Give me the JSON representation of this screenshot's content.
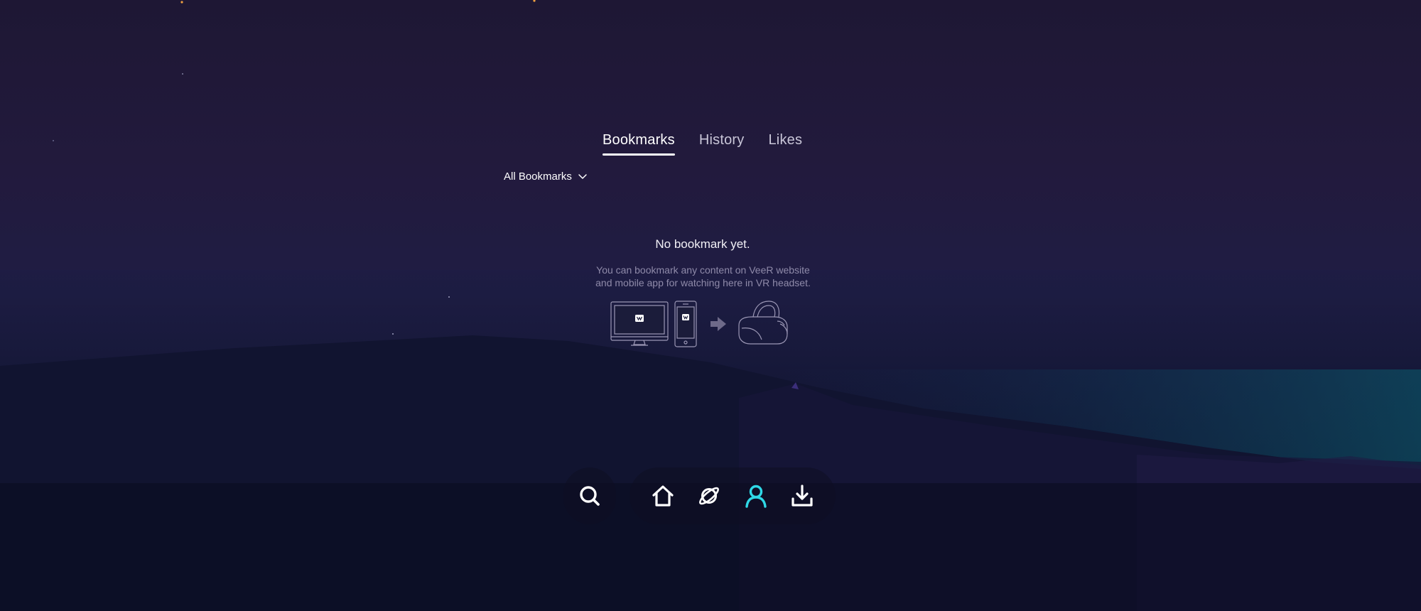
{
  "tabs": [
    {
      "label": "Bookmarks",
      "active": true
    },
    {
      "label": "History",
      "active": false
    },
    {
      "label": "Likes",
      "active": false
    }
  ],
  "filter": {
    "label": "All Bookmarks",
    "icon": "chevron-down-icon"
  },
  "empty_state": {
    "title": "No bookmark yet.",
    "description_line1": "You can bookmark any content on VeeR website",
    "description_line2": "and mobile app for watching here in VR headset.",
    "illustration": [
      "monitor-icon",
      "phone-icon",
      "arrow-right-icon",
      "vr-headset-icon"
    ]
  },
  "bottom_nav": {
    "search": {
      "icon": "search-icon"
    },
    "items": [
      {
        "icon": "home-icon",
        "active": false
      },
      {
        "icon": "planet-icon",
        "active": false
      },
      {
        "icon": "user-icon",
        "active": true
      },
      {
        "icon": "download-icon",
        "active": false
      }
    ]
  },
  "colors": {
    "accent": "#2fd8e6",
    "text_primary": "#ffffff",
    "text_secondary": "#8f8aa9"
  }
}
